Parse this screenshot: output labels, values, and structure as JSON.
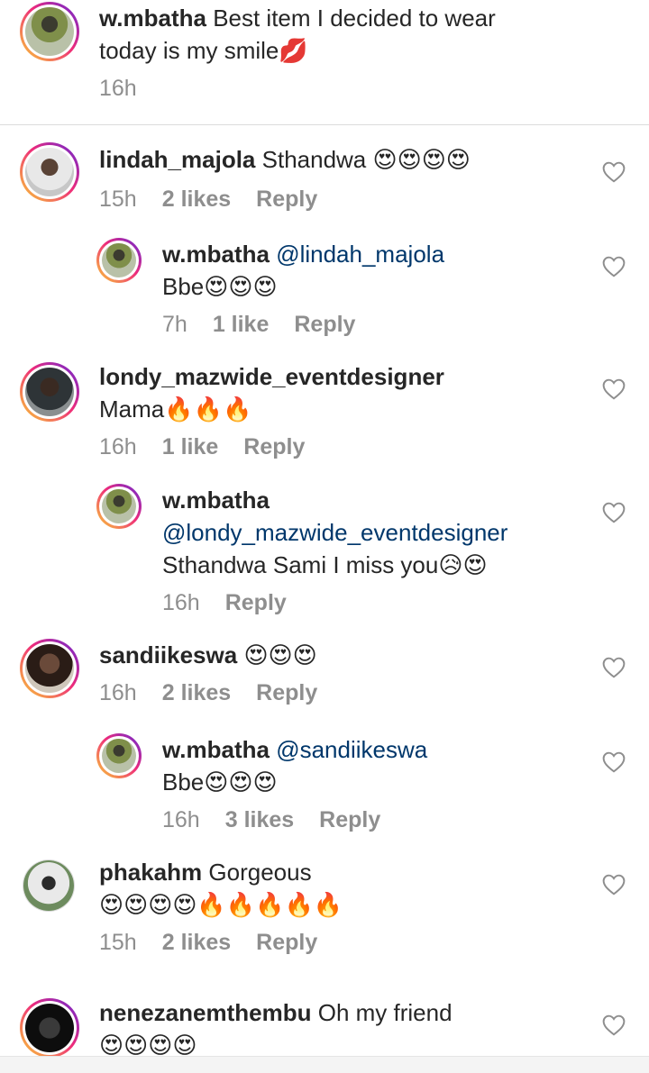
{
  "caption": {
    "username": "w.mbatha",
    "text_line1": "Best item I decided to wear",
    "text_line2": "today is my smile💋",
    "time": "16h"
  },
  "comments": [
    {
      "username": "lindah_majola",
      "text": "Sthandwa 😍😍😍😍",
      "time": "15h",
      "likes": "2 likes",
      "reply_label": "Reply"
    },
    {
      "username": "w.mbatha",
      "mention": "@lindah_majola",
      "text": "Bbe😍😍😍",
      "time": "7h",
      "likes": "1 like",
      "reply_label": "Reply"
    },
    {
      "username": "londy_mazwide_eventdesigner",
      "text": "Mama🔥🔥🔥",
      "time": "16h",
      "likes": "1 like",
      "reply_label": "Reply"
    },
    {
      "username": "w.mbatha",
      "mention": "@londy_mazwide_eventdesigner",
      "text": "Sthandwa Sami I miss you😥😍",
      "time": "16h",
      "reply_label": "Reply"
    },
    {
      "username": "sandiikeswa",
      "text": "😍😍😍",
      "time": "16h",
      "likes": "2 likes",
      "reply_label": "Reply"
    },
    {
      "username": "w.mbatha",
      "mention": "@sandiikeswa",
      "text": "Bbe😍😍😍",
      "time": "16h",
      "likes": "3 likes",
      "reply_label": "Reply"
    },
    {
      "username": "phakahm",
      "text": "Gorgeous",
      "text_line2": "😍😍😍😍🔥🔥🔥🔥🔥",
      "time": "15h",
      "likes": "2 likes",
      "reply_label": "Reply"
    },
    {
      "username": "nenezanemthembu",
      "text": "Oh my friend",
      "text_line2": "😍😍😍😍"
    }
  ],
  "icons": {
    "like": "heart-outline-icon",
    "accent": "#00376b",
    "muted": "#8e8e8e"
  }
}
